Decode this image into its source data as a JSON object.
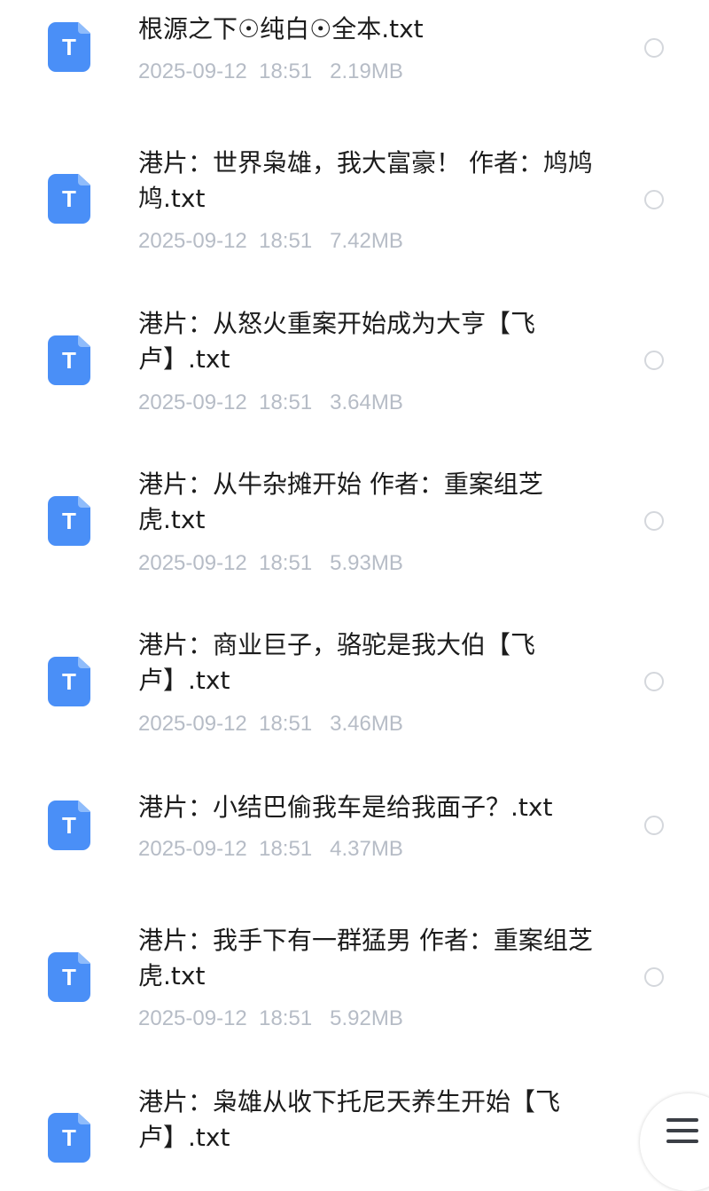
{
  "files": [
    {
      "name": "根源之下☉纯白☉全本.txt",
      "meta": "2025-09-12  18:51   2.19MB",
      "icon_letter": "T"
    },
    {
      "name": "港片：世界枭雄，我大富豪！ 作者：鸠鸠鸠.txt",
      "meta": "2025-09-12  18:51   7.42MB",
      "icon_letter": "T"
    },
    {
      "name": "港片：从怒火重案开始成为大亨【飞卢】.txt",
      "meta": "2025-09-12  18:51   3.64MB",
      "icon_letter": "T"
    },
    {
      "name": "港片：从牛杂摊开始 作者：重案组芝虎.txt",
      "meta": "2025-09-12  18:51   5.93MB",
      "icon_letter": "T"
    },
    {
      "name": "港片：商业巨子，骆驼是我大伯【飞卢】.txt",
      "meta": "2025-09-12  18:51   3.46MB",
      "icon_letter": "T"
    },
    {
      "name": "港片：小结巴偷我车是给我面子？.txt",
      "meta": "2025-09-12  18:51   4.37MB",
      "icon_letter": "T"
    },
    {
      "name": "港片：我手下有一群猛男 作者：重案组芝虎.txt",
      "meta": "2025-09-12  18:51   5.92MB",
      "icon_letter": "T"
    },
    {
      "name": "港片：枭雄从收下托尼天养生开始【飞卢】.txt",
      "meta": "",
      "icon_letter": "T"
    }
  ],
  "colors": {
    "icon_blue": "#4a8ff7",
    "meta_gray": "#b6bcc6",
    "title_black": "#1c1c1c"
  },
  "icons": {
    "file": "txt-file-icon",
    "select": "radio-circle-icon",
    "menu": "hamburger-menu-icon"
  }
}
